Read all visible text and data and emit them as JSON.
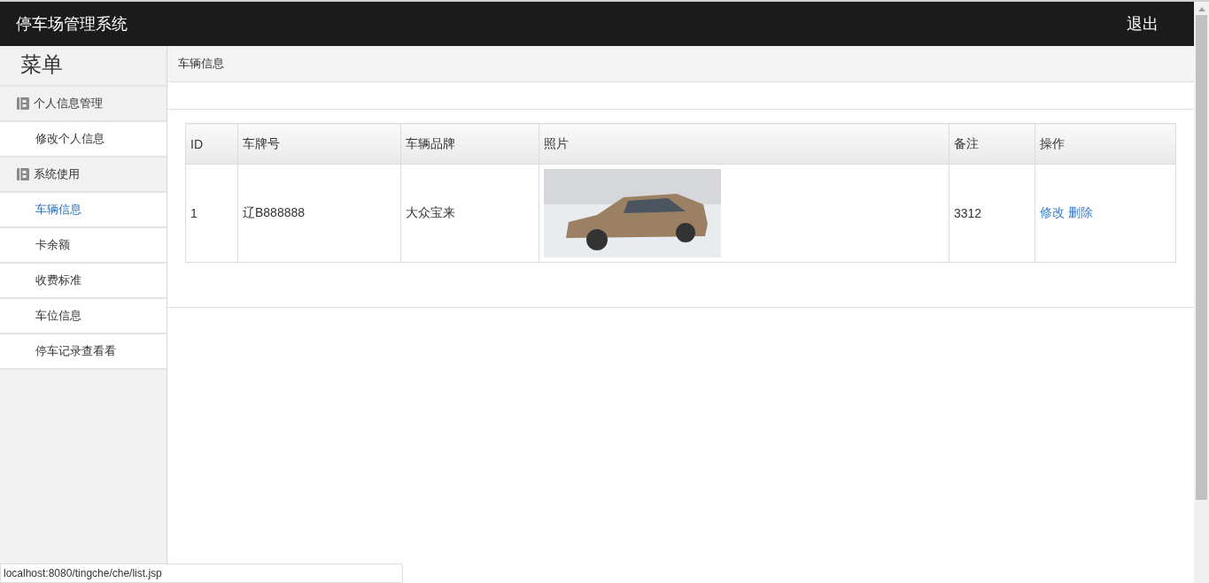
{
  "header": {
    "title": "停车场管理系统",
    "logout": "退出"
  },
  "sidebar": {
    "title": "菜单",
    "groups": [
      {
        "label": "个人信息管理",
        "items": [
          {
            "label": "修改个人信息",
            "selected": false
          }
        ]
      },
      {
        "label": "系统使用",
        "items": [
          {
            "label": "车辆信息",
            "selected": true
          },
          {
            "label": "卡余额",
            "selected": false
          },
          {
            "label": "收费标准",
            "selected": false
          },
          {
            "label": "车位信息",
            "selected": false
          },
          {
            "label": "停车记录查看看",
            "selected": false
          }
        ]
      }
    ]
  },
  "breadcrumb": "车辆信息",
  "table": {
    "columns": [
      "ID",
      "车牌号",
      "车辆品牌",
      "照片",
      "备注",
      "操作"
    ],
    "rows": [
      {
        "id": "1",
        "plate": "辽B888888",
        "brand": "大众宝来",
        "remark": "3312",
        "actions": [
          "修改",
          "删除"
        ]
      }
    ]
  },
  "status_bar": "localhost:8080/tingche/che/list.jsp"
}
